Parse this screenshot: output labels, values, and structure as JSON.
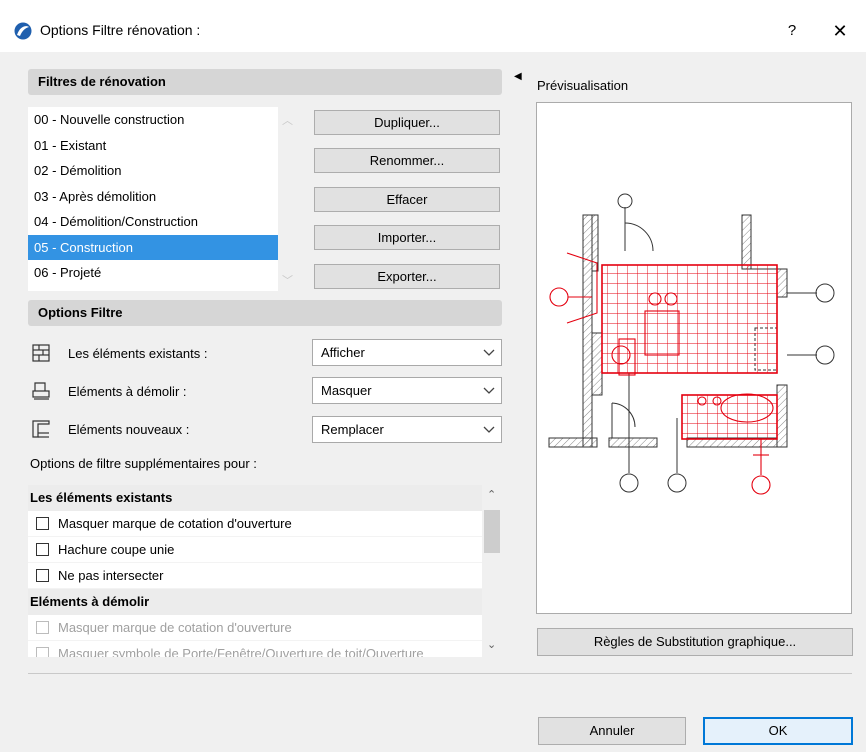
{
  "window": {
    "title": "Options Filtre rénovation :",
    "help_label": "?",
    "close_label": "✕"
  },
  "filters": {
    "header": "Filtres de rénovation",
    "items": [
      "00 - Nouvelle construction",
      "01 - Existant",
      "02 - Démolition",
      "03 - Après démolition",
      "04 - Démolition/Construction",
      "05 - Construction",
      "06 - Projeté"
    ],
    "selected_index": 5,
    "buttons": {
      "duplicate": "Dupliquer...",
      "rename": "Renommer...",
      "delete": "Effacer",
      "import": "Importer...",
      "export": "Exporter..."
    }
  },
  "filter_options": {
    "header": "Options Filtre",
    "rows": [
      {
        "label": "Les éléments existants :",
        "value": "Afficher",
        "icon": "existing-elements-icon"
      },
      {
        "label": "Eléments à démolir :",
        "value": "Masquer",
        "icon": "demolish-elements-icon"
      },
      {
        "label": "Eléments nouveaux :",
        "value": "Remplacer",
        "icon": "new-elements-icon"
      }
    ]
  },
  "extra_options": {
    "label": "Options de filtre supplémentaires pour :",
    "groups": [
      {
        "title": "Les éléments existants",
        "items": [
          {
            "label": "Masquer marque de cotation d'ouverture",
            "checked": false,
            "disabled": false
          },
          {
            "label": "Hachure coupe unie",
            "checked": false,
            "disabled": false
          },
          {
            "label": "Ne pas intersecter",
            "checked": false,
            "disabled": false
          }
        ]
      },
      {
        "title": "Eléments à démolir",
        "items": [
          {
            "label": "Masquer marque de cotation d'ouverture",
            "checked": false,
            "disabled": true
          },
          {
            "label": "Masquer symbole de Porte/Fenêtre/Ouverture de toit/Ouverture",
            "checked": false,
            "disabled": true
          }
        ]
      }
    ]
  },
  "preview": {
    "label": "Prévisualisation",
    "accent_color": "#e4000f"
  },
  "footer": {
    "substitution_button": "Règles de Substitution graphique...",
    "cancel": "Annuler",
    "ok": "OK"
  }
}
